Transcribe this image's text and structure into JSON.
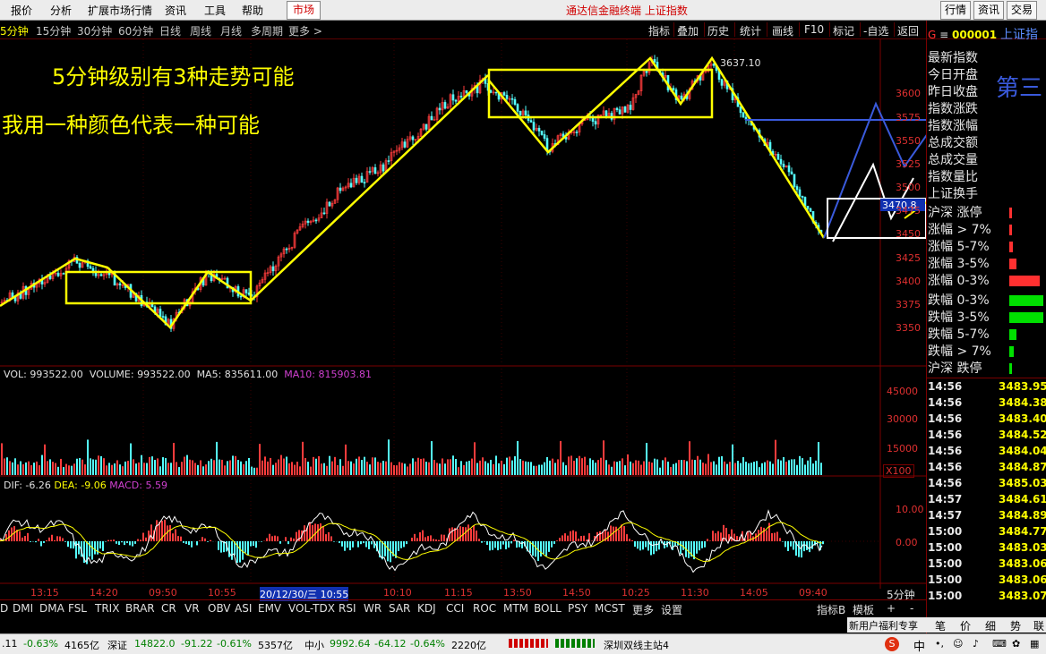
{
  "menubar": {
    "items": [
      "报价",
      "分析",
      "扩展市场行情",
      "资讯",
      "工具",
      "帮助"
    ],
    "market": "市场",
    "title": "通达信金融终端 上证指数",
    "right_buttons": [
      "行情",
      "资讯",
      "交易"
    ]
  },
  "periods": [
    "5分钟",
    "15分钟",
    "30分钟",
    "60分钟",
    "日线",
    "周线",
    "月线",
    "多周期",
    "更多 >"
  ],
  "toolbar": [
    "指标",
    "叠加",
    "历史",
    "统计",
    "画线",
    "F10",
    "标记",
    "-自选",
    "返回"
  ],
  "annotations": {
    "line1": "5分钟级别有3种走势可能",
    "line2": "我用一种颜色代表一种可能",
    "side1": "第三",
    "peak_price": "3637.10",
    "cursor_price": "3470.8"
  },
  "price_axis": [
    "3600",
    "3575",
    "3550",
    "3525",
    "3500",
    "3475",
    "3450",
    "3425",
    "3400",
    "3375",
    "3350"
  ],
  "vol_header": {
    "a": "VOL: 993522.00",
    "b": "VOLUME: 993522.00",
    "c": "MA5: 835611.00",
    "d": "MA10: 815903.81"
  },
  "vol_axis": [
    "45000",
    "30000",
    "15000"
  ],
  "vol_unit": "X100",
  "macd_header": {
    "dif": "DIF: -6.26",
    "dea": "DEA: -9.06",
    "macd": "MACD: 5.59"
  },
  "macd_axis": [
    "10.00",
    "0.00"
  ],
  "time_axis": [
    "13:15",
    "14:20",
    "09:50",
    "10:55",
    "20/12/30/三 10:55",
    "10:10",
    "11:15",
    "13:50",
    "14:50",
    "10:25",
    "11:30",
    "14:05",
    "09:40"
  ],
  "period_label": "5分钟",
  "indicators": [
    "D",
    "DMI",
    "DMA",
    "FSL",
    "TRIX",
    "BRAR",
    "CR",
    "VR",
    "OBV",
    "ASI",
    "EMV",
    "VOL-TDX",
    "RSI",
    "WR",
    "SAR",
    "KDJ",
    "CCI",
    "ROC",
    "MTM",
    "BOLL",
    "PSY",
    "MCST",
    "更多",
    "设置"
  ],
  "indicator_right": [
    "指标B",
    "模板",
    "+",
    "-"
  ],
  "right_panel": {
    "g": "G",
    "code": "000001",
    "name": "上证指",
    "stats": [
      "最新指数",
      "今日开盘",
      "昨日收盘",
      "指数涨跌",
      "指数涨幅",
      "总成交额",
      "总成交量",
      "指数量比",
      "上证换手"
    ],
    "dist": [
      "沪深 涨停",
      "涨幅 > 7%",
      "涨幅 5-7%",
      "涨幅 3-5%",
      "涨幅 0-3%",
      "跌幅 0-3%",
      "跌幅 3-5%",
      "跌幅 5-7%",
      "跌幅 > 7%",
      "沪深 跌停"
    ],
    "ticks": [
      {
        "t": "14:56",
        "p": "3483.95"
      },
      {
        "t": "14:56",
        "p": "3484.38"
      },
      {
        "t": "14:56",
        "p": "3483.40"
      },
      {
        "t": "14:56",
        "p": "3484.52"
      },
      {
        "t": "14:56",
        "p": "3484.04"
      },
      {
        "t": "14:56",
        "p": "3484.87"
      },
      {
        "t": "14:56",
        "p": "3485.03"
      },
      {
        "t": "14:57",
        "p": "3484.61"
      },
      {
        "t": "14:57",
        "p": "3484.89"
      },
      {
        "t": "15:00",
        "p": "3484.77"
      },
      {
        "t": "15:00",
        "p": "3483.03"
      },
      {
        "t": "15:00",
        "p": "3483.06"
      },
      {
        "t": "15:00",
        "p": "3483.06"
      },
      {
        "t": "15:00",
        "p": "3483.07"
      }
    ],
    "bottom_tabs": [
      "新用户福利专享",
      "笔",
      "价",
      "细",
      "势",
      "联"
    ]
  },
  "statusbar": {
    "s1": ".11",
    "s2": "-0.63%",
    "s3": "4165亿",
    "s4": "深证",
    "s5": "14822.0",
    "s6": "-91.22",
    "s7": "-0.61%",
    "s8": "5357亿",
    "s9": "中小",
    "s10": "9992.64",
    "s11": "-64.12",
    "s12": "-0.64%",
    "s13": "2220亿",
    "s14": "深圳双线主站4",
    "s15": "中"
  }
}
